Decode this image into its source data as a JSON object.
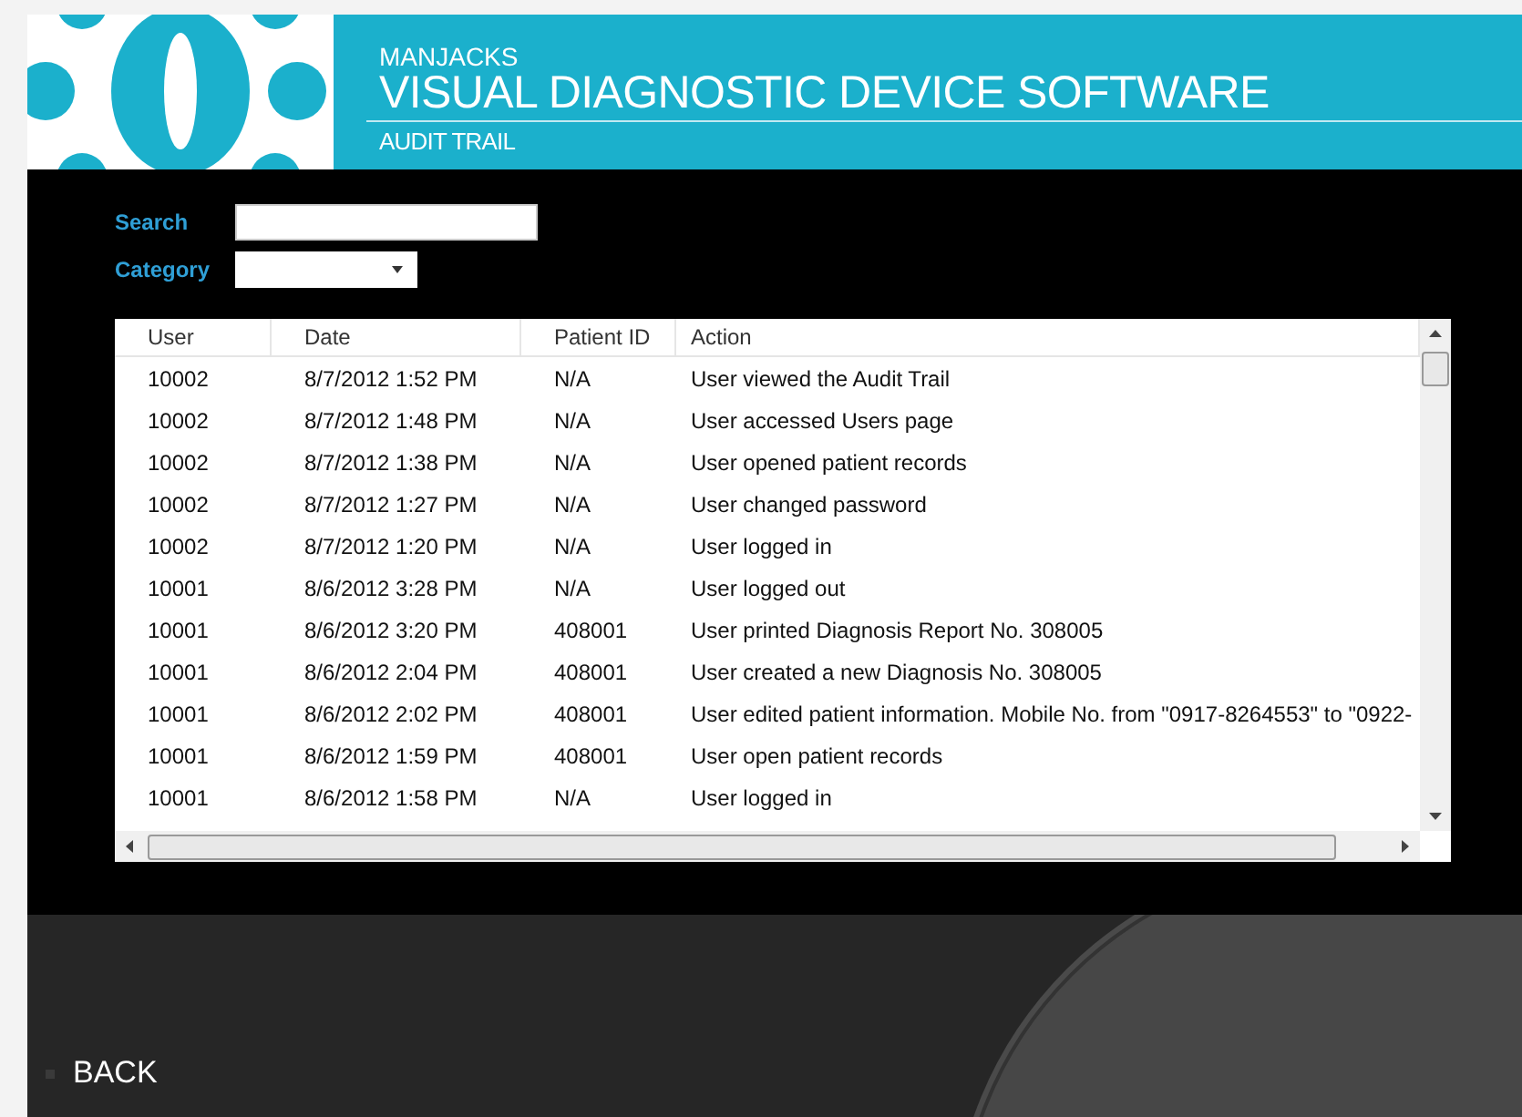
{
  "header": {
    "brand": "MANJACKS",
    "title": "VISUAL DIAGNOSTIC DEVICE SOFTWARE",
    "subtitle": "AUDIT TRAIL"
  },
  "filters": {
    "search_label": "Search",
    "category_label": "Category"
  },
  "table": {
    "columns": [
      "User",
      "Date",
      "Patient ID",
      "Action"
    ],
    "rows": [
      [
        "10002",
        "8/7/2012 1:52 PM",
        "N/A",
        "User viewed the Audit Trail"
      ],
      [
        "10002",
        "8/7/2012 1:48 PM",
        "N/A",
        "User accessed Users page"
      ],
      [
        "10002",
        "8/7/2012 1:38 PM",
        "N/A",
        "User opened patient records"
      ],
      [
        "10002",
        "8/7/2012 1:27 PM",
        "N/A",
        "User changed password"
      ],
      [
        "10002",
        "8/7/2012 1:20 PM",
        "N/A",
        "User logged in"
      ],
      [
        "10001",
        "8/6/2012 3:28 PM",
        "N/A",
        "User logged out"
      ],
      [
        "10001",
        "8/6/2012 3:20 PM",
        "408001",
        "User printed Diagnosis Report No. 308005"
      ],
      [
        "10001",
        "8/6/2012 2:04 PM",
        "408001",
        "User created a new Diagnosis No. 308005"
      ],
      [
        "10001",
        "8/6/2012 2:02 PM",
        "408001",
        "User edited patient information. Mobile No. from \"0917-8264553\" to \"0922-"
      ],
      [
        "10001",
        "8/6/2012 1:59 PM",
        "408001",
        "User open patient records"
      ],
      [
        "10001",
        "8/6/2012 1:58 PM",
        "N/A",
        "User logged in"
      ]
    ]
  },
  "footer": {
    "back": "BACK"
  }
}
